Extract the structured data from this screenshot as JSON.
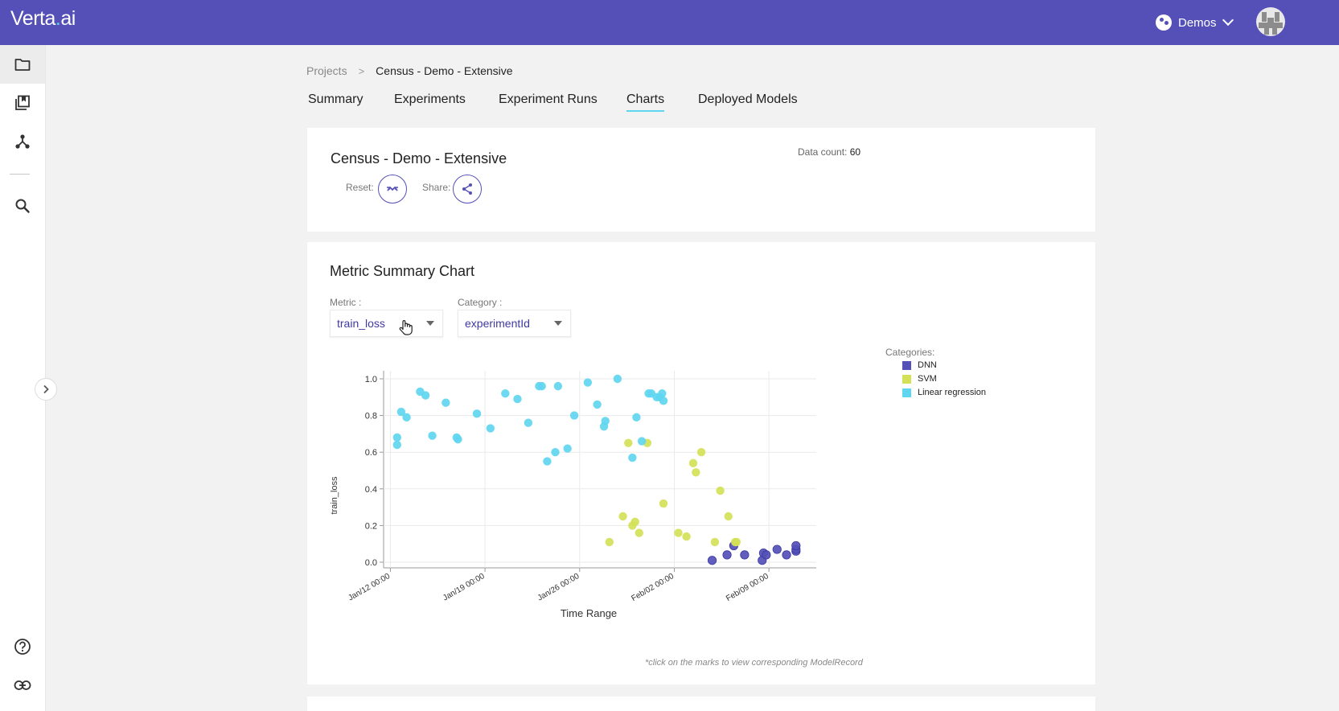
{
  "app": {
    "logo_main": "Verta",
    "logo_dot": ".",
    "logo_tail": "ai"
  },
  "workspace": {
    "label": "Demos"
  },
  "breadcrumb": {
    "root": "Projects",
    "separator": ">",
    "current": "Census - Demo - Extensive"
  },
  "tabs": [
    {
      "label": "Summary"
    },
    {
      "label": "Experiments"
    },
    {
      "label": "Experiment Runs"
    },
    {
      "label": "Charts",
      "active": true
    },
    {
      "label": "Deployed Models"
    }
  ],
  "project_card": {
    "title": "Census - Demo - Extensive",
    "data_count_label": "Data count:",
    "data_count": "60",
    "reset_label": "Reset:",
    "share_label": "Share:"
  },
  "chart_card": {
    "title": "Metric Summary Chart",
    "metric_label": "Metric :",
    "metric_value": "train_loss",
    "category_label": "Category :",
    "category_value": "experimentId",
    "legend_title": "Categories:",
    "hint": "*click on the marks to view corresponding ModelRecord"
  },
  "colors": {
    "accent": "#5450b8",
    "tab_underline": "#5fd6f0",
    "dnn": "#5450b8",
    "svm": "#d4e157",
    "linear": "#5fd6f0"
  },
  "icons": [
    "folder-icon",
    "bookmark-stack-icon",
    "hierarchy-icon",
    "search-icon",
    "help-icon",
    "link-icon",
    "chevron-right-icon",
    "reset-icon",
    "share-icon"
  ],
  "chart_data": {
    "type": "scatter",
    "xlabel": "Time Range",
    "ylabel": "train_loss",
    "ylim": [
      0,
      1.0
    ],
    "y_ticks": [
      "0.0",
      "0.2",
      "0.4",
      "0.6",
      "0.8",
      "1.0"
    ],
    "x_ticks": [
      "Jan/12 00:00",
      "Jan/19 00:00",
      "Jan/26 00:00",
      "Feb/02 00:00",
      "Feb/09 00:00"
    ],
    "xlim_days": [
      -0.5,
      31.5
    ],
    "legend_placement": "right",
    "grid": true,
    "series": [
      {
        "name": "DNN",
        "color": "#5450b8",
        "x": [
          23.8,
          24.9,
          25.4,
          26.2,
          27.5,
          27.6,
          27.8,
          28.6,
          29.3,
          30.0,
          30.0,
          30.0
        ],
        "y": [
          0.01,
          0.04,
          0.09,
          0.04,
          0.01,
          0.05,
          0.04,
          0.07,
          0.04,
          0.06,
          0.07,
          0.09
        ]
      },
      {
        "name": "SVM",
        "color": "#d4e157",
        "x": [
          16.2,
          17.2,
          17.6,
          17.9,
          18.1,
          18.4,
          19.0,
          20.2,
          21.3,
          21.9,
          22.4,
          22.6,
          23.0,
          24.0,
          24.4,
          25.0,
          25.5,
          25.6
        ],
        "y": [
          0.11,
          0.25,
          0.65,
          0.2,
          0.22,
          0.16,
          0.65,
          0.32,
          0.16,
          0.14,
          0.54,
          0.49,
          0.6,
          0.11,
          0.39,
          0.25,
          0.11,
          0.11
        ],
        "_note_": ""
      },
      {
        "name": "Linear regression",
        "color": "#5fd6f0",
        "x": [
          0.5,
          0.5,
          0.8,
          1.2,
          2.2,
          2.6,
          3.1,
          4.1,
          4.9,
          5.0,
          6.4,
          7.4,
          8.5,
          9.4,
          10.2,
          11.0,
          11.2,
          11.6,
          12.2,
          12.4,
          13.1,
          13.6,
          14.6,
          15.3,
          15.8,
          15.9,
          16.8,
          17.9,
          18.2,
          18.6,
          19.1,
          19.3,
          19.7,
          19.9,
          20.1,
          20.2
        ],
        "y": [
          0.68,
          0.64,
          0.82,
          0.79,
          0.93,
          0.91,
          0.69,
          0.87,
          0.68,
          0.67,
          0.81,
          0.73,
          0.92,
          0.89,
          0.76,
          0.96,
          0.96,
          0.55,
          0.6,
          0.96,
          0.62,
          0.8,
          0.98,
          0.86,
          0.74,
          0.77,
          1.0,
          0.57,
          0.79,
          0.66,
          0.92,
          0.92,
          0.9,
          0.9,
          0.92,
          0.88
        ]
      }
    ]
  }
}
